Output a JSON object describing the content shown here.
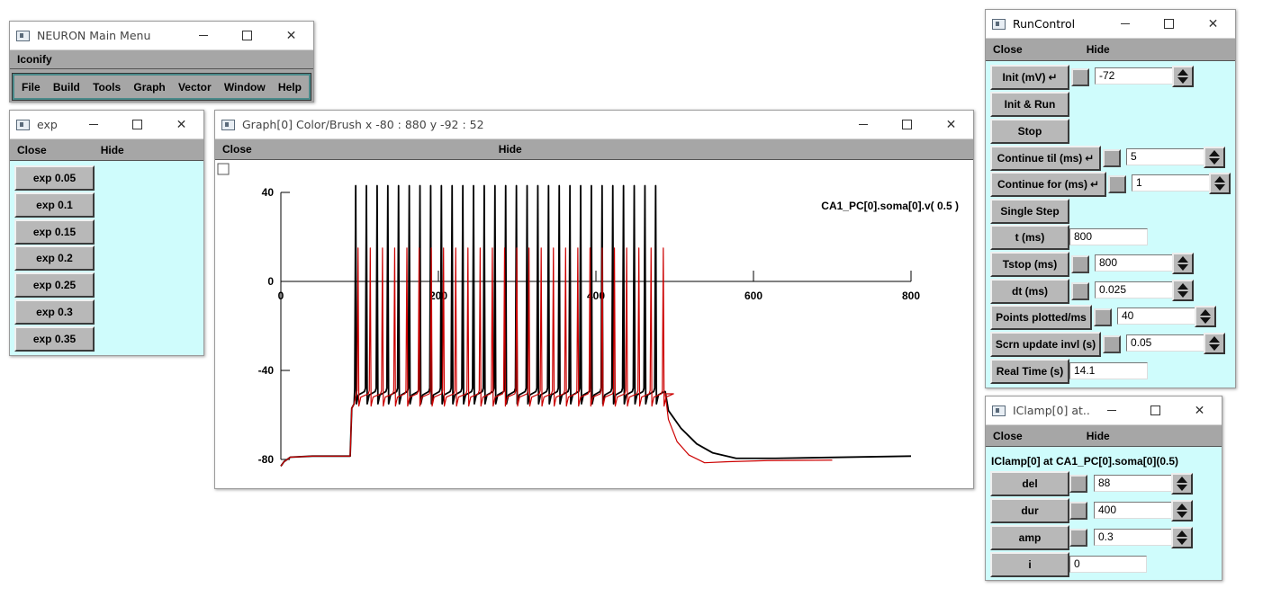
{
  "main_menu": {
    "title": "NEURON Main Menu",
    "iconify": "Iconify",
    "items": [
      "File",
      "Build",
      "Tools",
      "Graph",
      "Vector",
      "Window",
      "Help"
    ]
  },
  "exp_panel": {
    "title": "exp",
    "close": "Close",
    "hide": "Hide",
    "buttons": [
      "exp 0.05",
      "exp 0.1",
      "exp 0.15",
      "exp 0.2",
      "exp 0.25",
      "exp 0.3",
      "exp 0.35"
    ]
  },
  "graph": {
    "title": "Graph[0] Color/Brush x -80 : 880  y -92 : 52",
    "close": "Close",
    "hide": "Hide",
    "trace_label": "CA1_PC[0].soma[0].v( 0.5 )",
    "x_ticks": [
      "0",
      "200",
      "400",
      "600",
      "800"
    ],
    "y_ticks": [
      "40",
      "0",
      "-40",
      "-80"
    ]
  },
  "chart_data": {
    "type": "line",
    "xlabel": "",
    "ylabel": "",
    "xlim": [
      0,
      800
    ],
    "ylim": [
      -80,
      40
    ],
    "series": [
      {
        "name": "CA1_PC[0].soma[0].v( 0.5 )",
        "color": "#000000",
        "stim": {
          "start": 88,
          "end": 488,
          "period": 13.6,
          "first_spike": 95,
          "peak": 43,
          "trough": -51,
          "rest": -80
        }
      },
      {
        "color": "#cc0000",
        "stim": {
          "start": 88,
          "end": 488,
          "period": 15.5,
          "first_spike": 98,
          "peak": 15,
          "trough": -52,
          "rest": -80,
          "end_x": 700
        }
      }
    ]
  },
  "runcontrol": {
    "title": "RunControl",
    "close": "Close",
    "hide": "Hide",
    "init_label": "Init (mV)",
    "init_value": "-72",
    "init_run": "Init & Run",
    "stop": "Stop",
    "continue_til_label": "Continue til (ms)",
    "continue_til_value": "5",
    "continue_for_label": "Continue for (ms)",
    "continue_for_value": "1",
    "single_step": "Single Step",
    "t_label": "t (ms)",
    "t_value": "800",
    "tstop_label": "Tstop (ms)",
    "tstop_value": "800",
    "dt_label": "dt (ms)",
    "dt_value": "0.025",
    "points_label": "Points plotted/ms",
    "points_value": "40",
    "scrn_label": "Scrn update invl (s)",
    "scrn_value": "0.05",
    "realtime_label": "Real Time (s)",
    "realtime_value": "14.1"
  },
  "iclamp": {
    "title": "IClamp[0] at...",
    "close": "Close",
    "hide": "Hide",
    "heading": "IClamp[0] at CA1_PC[0].soma[0](0.5)",
    "del_label": "del",
    "del_value": "88",
    "dur_label": "dur",
    "dur_value": "400",
    "amp_label": "amp",
    "amp_value": "0.3",
    "i_label": "i",
    "i_value": "0"
  }
}
